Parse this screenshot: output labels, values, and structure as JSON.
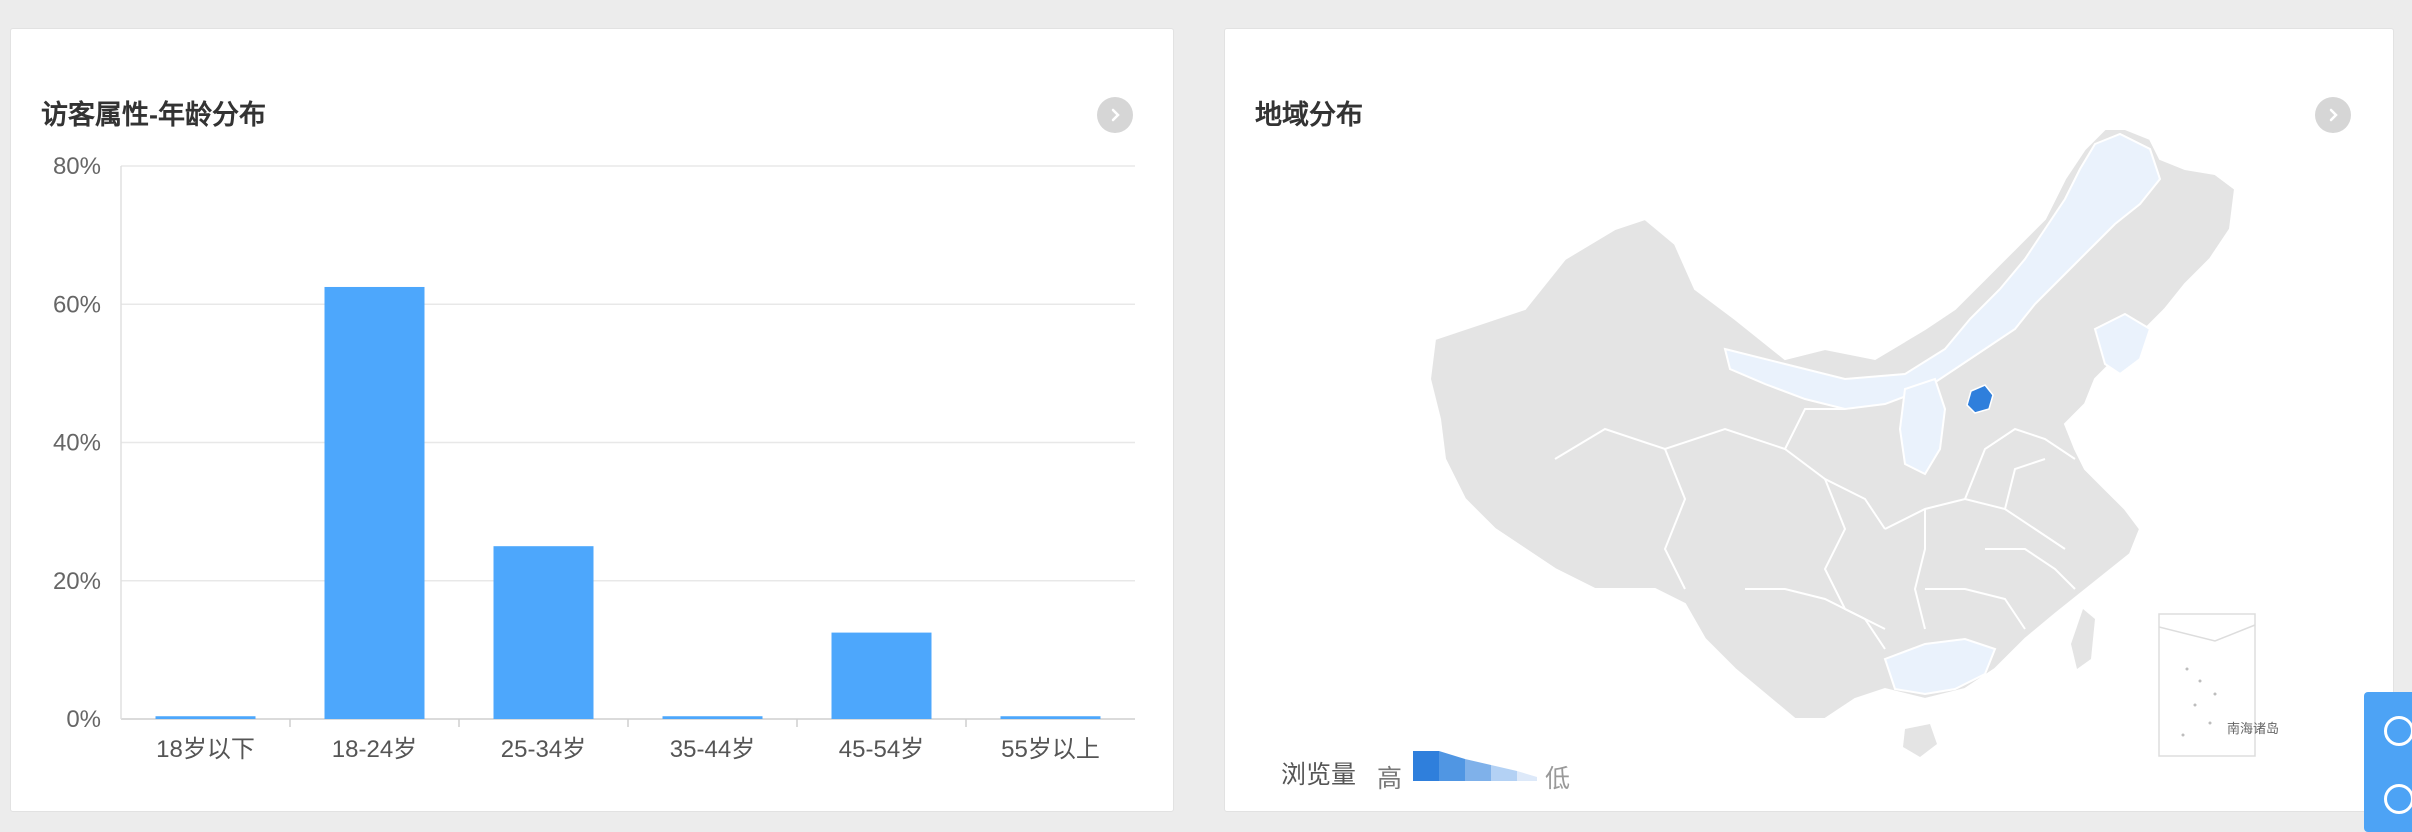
{
  "age_card": {
    "title": "访客属性-年龄分布",
    "more_icon": "chevron-right-circle-icon"
  },
  "region_card": {
    "title": "地域分布",
    "more_icon": "chevron-right-circle-icon",
    "legend": {
      "label": "浏览量",
      "high": "高",
      "low": "低"
    },
    "inset_label": "南海诸岛",
    "colors": {
      "high": "#2f7fdc",
      "low": "#eaf2fc",
      "base": "#e4e4e4"
    }
  },
  "side_widget": {
    "icons": [
      "feedback-icon",
      "edit-icon"
    ]
  },
  "chart_data": {
    "type": "bar",
    "categories": [
      "18岁以下",
      "18-24岁",
      "25-34岁",
      "35-44岁",
      "45-54岁",
      "55岁以上"
    ],
    "values": [
      0.4,
      62.5,
      25.0,
      0.4,
      12.5,
      0.4
    ],
    "yticks": [
      "0%",
      "20%",
      "40%",
      "60%",
      "80%"
    ],
    "ylim": [
      0,
      80
    ],
    "grid": true,
    "color": "#4da7fc"
  }
}
